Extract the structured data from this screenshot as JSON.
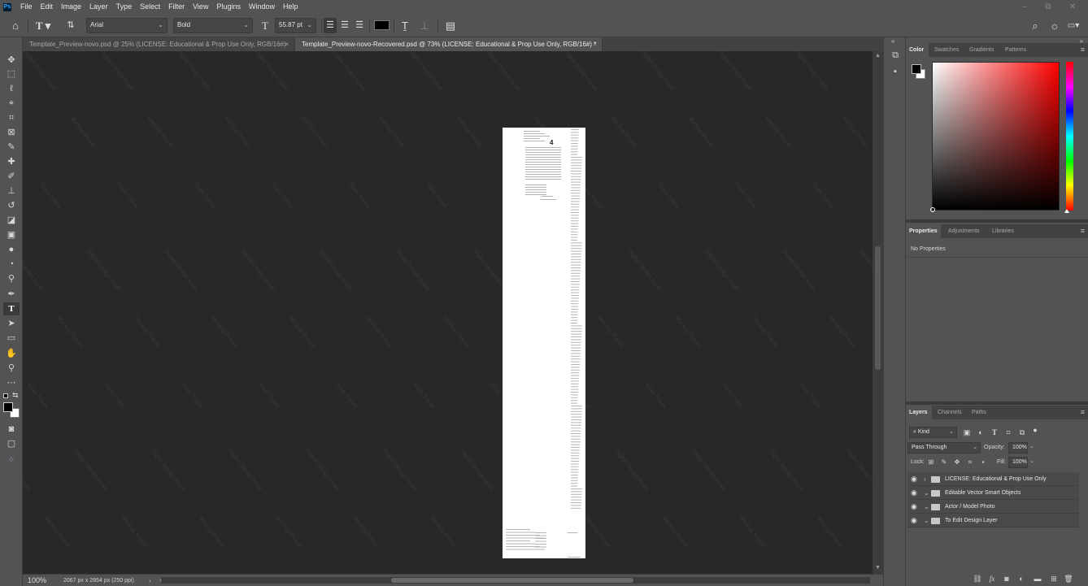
{
  "app": {
    "logo": "Ps"
  },
  "menu": [
    "File",
    "Edit",
    "Image",
    "Layer",
    "Type",
    "Select",
    "Filter",
    "View",
    "Plugins",
    "Window",
    "Help"
  ],
  "window_controls": {
    "minimize": "–",
    "restore": "⧉",
    "close": "✕"
  },
  "options_bar": {
    "font_family": "Arial",
    "font_style": "Bold",
    "font_size": "55.87 pt"
  },
  "tabs": [
    {
      "label": "Template_Preview-novo.psd @ 25% (LICENSE: Educational & Prop Use Only, RGB/16#)",
      "close": "×"
    },
    {
      "label": "Template_Preview-novo-Recovered.psd @ 73% (LICENSE: Educational & Prop Use Only, RGB/16#) *",
      "close": "×"
    }
  ],
  "canvas": {
    "watermark_texts": [
      "Digital Design Asset",
      "Mockup Preset",
      "Novo Travel"
    ],
    "document_number": "4",
    "background": "#282828"
  },
  "status_bar": {
    "zoom": "100%",
    "doc_info": "2067 px x 2854 px (250 ppi)",
    "more_arrow": "›",
    "scroll_left": "‹"
  },
  "color_panel": {
    "tabs": [
      "Color",
      "Swatches",
      "Gradients",
      "Patterns"
    ],
    "foreground": "#000000",
    "background": "#ffffff"
  },
  "properties_panel": {
    "tabs": [
      "Properties",
      "Adjustments",
      "Libraries"
    ],
    "content": "No Properties"
  },
  "layers_panel": {
    "tabs": [
      "Layers",
      "Channels",
      "Paths"
    ],
    "filter_kind": "Kind",
    "blend_mode": "Pass Through",
    "opacity_label": "Opacity:",
    "opacity": "100%",
    "lock_label": "Lock:",
    "fill_label": "Fill:",
    "fill": "100%",
    "layers": [
      {
        "name": "LICENSE: Educational & Prop Use Only",
        "chevron": "›"
      },
      {
        "name": "Editable Vector Smart Objects",
        "chevron": "⌄"
      },
      {
        "name": "Actor / Model Photo",
        "chevron": "⌄"
      },
      {
        "name": "To Edit Design Layer",
        "chevron": "⌄"
      }
    ],
    "footer_icons": [
      "link-icon",
      "fx-icon",
      "mask-icon",
      "adjustment-icon",
      "group-icon",
      "new-layer-icon",
      "trash-icon"
    ]
  }
}
